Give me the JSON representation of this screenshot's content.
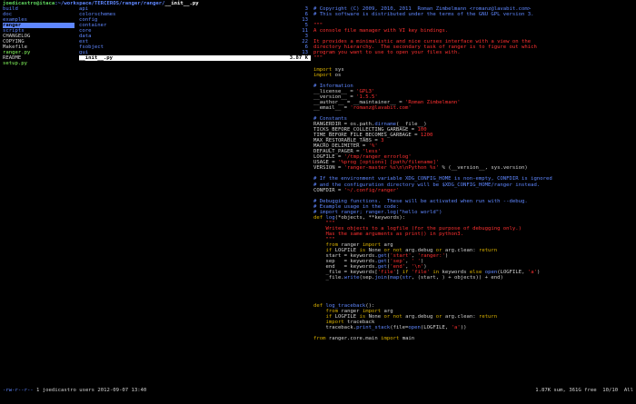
{
  "title": {
    "user_host": "joedicastro@itaca",
    "path": ":~/workspace/TERCEROS/ranger/ranger/",
    "file": "__init__.py"
  },
  "column1": [
    {
      "name": "build",
      "type": "dir"
    },
    {
      "name": "doc",
      "type": "dir"
    },
    {
      "name": "examples",
      "type": "dir"
    },
    {
      "name": "ranger",
      "type": "dir",
      "selected": true
    },
    {
      "name": "scripts",
      "type": "dir"
    },
    {
      "name": "CHANGELOG",
      "type": "file"
    },
    {
      "name": "COPYING",
      "type": "file"
    },
    {
      "name": "Makefile",
      "type": "file"
    },
    {
      "name": "ranger.py",
      "type": "exe"
    },
    {
      "name": "README",
      "type": "file"
    },
    {
      "name": "setup.py",
      "type": "exe"
    }
  ],
  "column2": [
    {
      "name": "api",
      "type": "dir",
      "count": "3"
    },
    {
      "name": "colorschemes",
      "type": "dir",
      "count": "6"
    },
    {
      "name": "config",
      "type": "dir",
      "count": "13"
    },
    {
      "name": "container",
      "type": "dir",
      "count": "5"
    },
    {
      "name": "core",
      "type": "dir",
      "count": "11"
    },
    {
      "name": "data",
      "type": "dir",
      "count": "3"
    },
    {
      "name": "ext",
      "type": "dir",
      "count": "22"
    },
    {
      "name": "fsobject",
      "type": "dir",
      "count": "6"
    },
    {
      "name": "gui",
      "type": "dir",
      "count": "13"
    },
    {
      "name": "__init__.py",
      "type": "file",
      "count": "3.87 K",
      "selected": true
    }
  ],
  "preview": [
    [
      [
        "c-com",
        "# Copyright (C) 2009, 2010, 2011  Roman Zimbelmann <romanz@lavabit.com>"
      ]
    ],
    [
      [
        "c-com",
        "# This software is distributed under the terms of the GNU GPL version 3."
      ]
    ],
    [],
    [
      [
        "c-str",
        "\"\"\""
      ]
    ],
    [
      [
        "c-str",
        "A console file manager with VI key bindings."
      ]
    ],
    [],
    [
      [
        "c-str",
        "It provides a minimalistic and nice curses interface with a view on the"
      ]
    ],
    [
      [
        "c-str",
        "directory hierarchy.  The secondary task of ranger is to figure out which"
      ]
    ],
    [
      [
        "c-str",
        "program you want to use to open your files with."
      ]
    ],
    [
      [
        "c-str",
        "\"\"\""
      ]
    ],
    [],
    [
      [
        "c-kw",
        "import"
      ],
      [
        "c-n",
        " sys"
      ]
    ],
    [
      [
        "c-kw",
        "import"
      ],
      [
        "c-n",
        " os"
      ]
    ],
    [],
    [
      [
        "c-com",
        "# Information"
      ]
    ],
    [
      [
        "c-n",
        "__license__ = "
      ],
      [
        "c-str",
        "'GPL3'"
      ]
    ],
    [
      [
        "c-n",
        "__version__ = "
      ],
      [
        "c-str",
        "'1.5.5'"
      ]
    ],
    [
      [
        "c-n",
        "__author__ = __maintainer__ = "
      ],
      [
        "c-str",
        "'Roman Zimbelmann'"
      ]
    ],
    [
      [
        "c-n",
        "__email__ = "
      ],
      [
        "c-str",
        "'romanz@lavabit.com'"
      ]
    ],
    [],
    [
      [
        "c-com",
        "# Constants"
      ]
    ],
    [
      [
        "c-n",
        "RANGERDIR = os.path."
      ],
      [
        "c-fn",
        "dirname"
      ],
      [
        "c-n",
        "(__file__)"
      ]
    ],
    [
      [
        "c-n",
        "TICKS_BEFORE_COLLECTING_GARBAGE = "
      ],
      [
        "c-str",
        "100"
      ]
    ],
    [
      [
        "c-n",
        "TIME_BEFORE_FILE_BECOMES_GARBAGE = "
      ],
      [
        "c-str",
        "1200"
      ]
    ],
    [
      [
        "c-n",
        "MAX_RESTORABLE_TABS = "
      ],
      [
        "c-str",
        "3"
      ]
    ],
    [
      [
        "c-n",
        "MACRO_DELIMITER = "
      ],
      [
        "c-str",
        "'%'"
      ]
    ],
    [
      [
        "c-n",
        "DEFAULT_PAGER = "
      ],
      [
        "c-str",
        "'less'"
      ]
    ],
    [
      [
        "c-n",
        "LOGFILE = "
      ],
      [
        "c-str",
        "'/tmp/ranger_errorlog'"
      ]
    ],
    [
      [
        "c-n",
        "USAGE = "
      ],
      [
        "c-str",
        "'%prog [options] [path/filename]'"
      ]
    ],
    [
      [
        "c-n",
        "VERSION = "
      ],
      [
        "c-str",
        "'ranger-master %s\\n\\nPython %s'"
      ],
      [
        "c-n",
        " % (__version__, sys.version)"
      ]
    ],
    [],
    [
      [
        "c-com",
        "# If the environment variable XDG_CONFIG_HOME is non-empty, CONFDIR is ignored"
      ]
    ],
    [
      [
        "c-com",
        "# and the configuration directory will be $XDG_CONFIG_HOME/ranger instead."
      ]
    ],
    [
      [
        "c-n",
        "CONFDIR = "
      ],
      [
        "c-str",
        "'~/.config/ranger'"
      ]
    ],
    [],
    [
      [
        "c-com",
        "# Debugging functions.  These will be activated when run with --debug."
      ]
    ],
    [
      [
        "c-com",
        "# Example usage in the code:"
      ]
    ],
    [
      [
        "c-com",
        "# import ranger; ranger.log(\"hello world\")"
      ]
    ],
    [
      [
        "c-kw",
        "def"
      ],
      [
        "c-n",
        " "
      ],
      [
        "c-fn",
        "log"
      ],
      [
        "c-n",
        "(*objects, **keywords):"
      ]
    ],
    [
      [
        "c-str",
        "    \"\"\""
      ]
    ],
    [
      [
        "c-str",
        "    Writes objects to a logfile (for the purpose of debugging only.)"
      ]
    ],
    [
      [
        "c-str",
        "    Has the same arguments as print() in python3."
      ]
    ],
    [
      [
        "c-str",
        "    \"\"\""
      ]
    ],
    [
      [
        "c-n",
        "    "
      ],
      [
        "c-kw",
        "from"
      ],
      [
        "c-n",
        " ranger "
      ],
      [
        "c-kw",
        "import"
      ],
      [
        "c-n",
        " arg"
      ]
    ],
    [
      [
        "c-n",
        "    "
      ],
      [
        "c-kw",
        "if"
      ],
      [
        "c-n",
        " LOGFILE "
      ],
      [
        "c-kw",
        "is"
      ],
      [
        "c-n",
        " None "
      ],
      [
        "c-kw",
        "or not"
      ],
      [
        "c-n",
        " arg.debug "
      ],
      [
        "c-kw",
        "or"
      ],
      [
        "c-n",
        " arg.clean: "
      ],
      [
        "c-kw",
        "return"
      ]
    ],
    [
      [
        "c-n",
        "    start = keywords."
      ],
      [
        "c-fn",
        "get"
      ],
      [
        "c-n",
        "("
      ],
      [
        "c-str",
        "'start'"
      ],
      [
        "c-n",
        ", "
      ],
      [
        "c-str",
        "'ranger:'"
      ],
      [
        "c-n",
        ")"
      ]
    ],
    [
      [
        "c-n",
        "    sep   = keywords."
      ],
      [
        "c-fn",
        "get"
      ],
      [
        "c-n",
        "("
      ],
      [
        "c-str",
        "'sep'"
      ],
      [
        "c-n",
        ", "
      ],
      [
        "c-str",
        "' '"
      ],
      [
        "c-n",
        ")"
      ]
    ],
    [
      [
        "c-n",
        "    end   = keywords."
      ],
      [
        "c-fn",
        "get"
      ],
      [
        "c-n",
        "("
      ],
      [
        "c-str",
        "'end'"
      ],
      [
        "c-n",
        ", "
      ],
      [
        "c-str",
        "'\\n'"
      ],
      [
        "c-n",
        ")"
      ]
    ],
    [
      [
        "c-n",
        "    _file = keywords["
      ],
      [
        "c-str",
        "'file'"
      ],
      [
        "c-n",
        "] "
      ],
      [
        "c-kw",
        "if"
      ],
      [
        "c-n",
        " "
      ],
      [
        "c-str",
        "'file'"
      ],
      [
        "c-n",
        " "
      ],
      [
        "c-kw",
        "in"
      ],
      [
        "c-n",
        " keywords "
      ],
      [
        "c-kw",
        "else"
      ],
      [
        "c-n",
        " "
      ],
      [
        "c-fn",
        "open"
      ],
      [
        "c-n",
        "(LOGFILE, "
      ],
      [
        "c-str",
        "'a'"
      ],
      [
        "c-n",
        ")"
      ]
    ],
    [
      [
        "c-n",
        "    _file."
      ],
      [
        "c-fn",
        "write"
      ],
      [
        "c-n",
        "(sep."
      ],
      [
        "c-fn",
        "join"
      ],
      [
        "c-n",
        "("
      ],
      [
        "c-fn",
        "map"
      ],
      [
        "c-n",
        "("
      ],
      [
        "c-fn",
        "str"
      ],
      [
        "c-n",
        ", (start, ) + objects)) + end)"
      ]
    ],
    [],
    [],
    [],
    [],
    [
      [
        "c-kw",
        "def"
      ],
      [
        "c-n",
        " "
      ],
      [
        "c-fn",
        "log_traceback"
      ],
      [
        "c-n",
        "():"
      ]
    ],
    [
      [
        "c-n",
        "    "
      ],
      [
        "c-kw",
        "from"
      ],
      [
        "c-n",
        " ranger "
      ],
      [
        "c-kw",
        "import"
      ],
      [
        "c-n",
        " arg"
      ]
    ],
    [
      [
        "c-n",
        "    "
      ],
      [
        "c-kw",
        "if"
      ],
      [
        "c-n",
        " LOGFILE "
      ],
      [
        "c-kw",
        "is"
      ],
      [
        "c-n",
        " None "
      ],
      [
        "c-kw",
        "or not"
      ],
      [
        "c-n",
        " arg.debug "
      ],
      [
        "c-kw",
        "or"
      ],
      [
        "c-n",
        " arg.clean: "
      ],
      [
        "c-kw",
        "return"
      ]
    ],
    [
      [
        "c-n",
        "    "
      ],
      [
        "c-kw",
        "import"
      ],
      [
        "c-n",
        " traceback"
      ]
    ],
    [
      [
        "c-n",
        "    traceback."
      ],
      [
        "c-fn",
        "print_stack"
      ],
      [
        "c-n",
        "(file="
      ],
      [
        "c-fn",
        "open"
      ],
      [
        "c-n",
        "(LOGFILE, "
      ],
      [
        "c-str",
        "'a'"
      ],
      [
        "c-n",
        "))"
      ]
    ],
    [],
    [
      [
        "c-kw",
        "from"
      ],
      [
        "c-n",
        " ranger.core.main "
      ],
      [
        "c-kw",
        "import"
      ],
      [
        "c-n",
        " main"
      ]
    ]
  ],
  "status": {
    "perms": "-rw-r--r--",
    "info": " 1 joedicastro users 2012-09-07 13:40",
    "right": "1.87K sum, 361G free  10/10  All"
  },
  "colors": {
    "directory": "#5f87ff",
    "executable": "#87ff5f",
    "string": "#ff3030",
    "keyword": "#d7af00",
    "comment": "#5f87ff"
  }
}
